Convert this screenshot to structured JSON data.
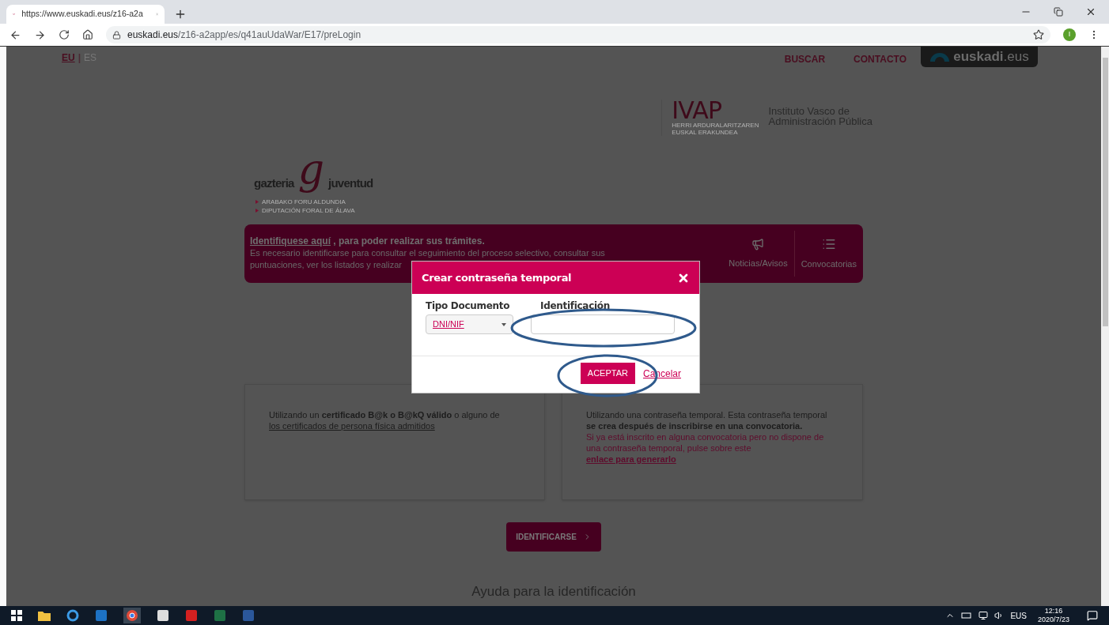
{
  "browser": {
    "tab_title": "https://www.euskadi.eus/z16-a2a",
    "url_domain": "euskadi.eus",
    "url_path": "/z16-a2app/es/q41auUdaWar/E17/preLogin",
    "profile_initial": "I"
  },
  "header": {
    "languages": [
      {
        "label": "EU",
        "selected": true
      },
      {
        "label": "ES",
        "selected": false
      }
    ],
    "separator": "|",
    "nav": [
      "BUSCAR",
      "CONTACTO"
    ],
    "brand": {
      "name": "euskadi",
      "suffix": ".eus"
    }
  },
  "ivap": {
    "logo": "IVAP",
    "logo_sub": [
      "HERRI ARDURALARITZAREN",
      "EUSKAL ERAKUNDEA"
    ],
    "name": [
      "Instituto Vasco de",
      "Administración Pública"
    ]
  },
  "gazteria": {
    "left": "gazteria",
    "mark": "g",
    "right": "juventud",
    "sub": [
      "ARABAKO FORU ALDUNDIA",
      "DIPUTACIÓN FORAL DE ÁLAVA"
    ]
  },
  "banner": {
    "link": "Identifiquese aquí",
    "title_rest": " , para poder realizar sus trámites.",
    "lines": [
      "Es necesario identificarse para consultar el seguimiento del proceso selectivo, consultar sus",
      "puntuaciones, ver los listados y realizar"
    ],
    "actions": [
      {
        "kind": "megaphone",
        "label": "Noticias/Avisos"
      },
      {
        "kind": "list",
        "label": "Convocatorias"
      }
    ]
  },
  "modal": {
    "title": "Crear contraseña temporal",
    "fields": [
      {
        "kind": "select",
        "label": "Tipo Documento",
        "value": "DNI/NIF"
      },
      {
        "kind": "input",
        "label": "Identificación"
      }
    ],
    "ok": "ACEPTAR",
    "cancel": "Cancelar"
  },
  "cards": [
    {
      "text": "Utilizando un **certificado B@k o B@kQ válido** o alguno de",
      "link": "los certificados de persona física admitidos"
    },
    {
      "text": "Utilizando una contraseña temporal. Esta contraseña temporal **se crea después de inscribirse en una convocatoria.**",
      "note": "Si ya está inscrito en alguna convocatoria pero no dispone de una contraseña temporal, pulse sobre este",
      "link": "enlace para generarlo"
    }
  ],
  "identify_button": "IDENTIFICARSE",
  "help_heading": "Ayuda para la identificación",
  "taskbar": {
    "language": "EUS",
    "time": "12:16",
    "date": "2020/7/23"
  }
}
